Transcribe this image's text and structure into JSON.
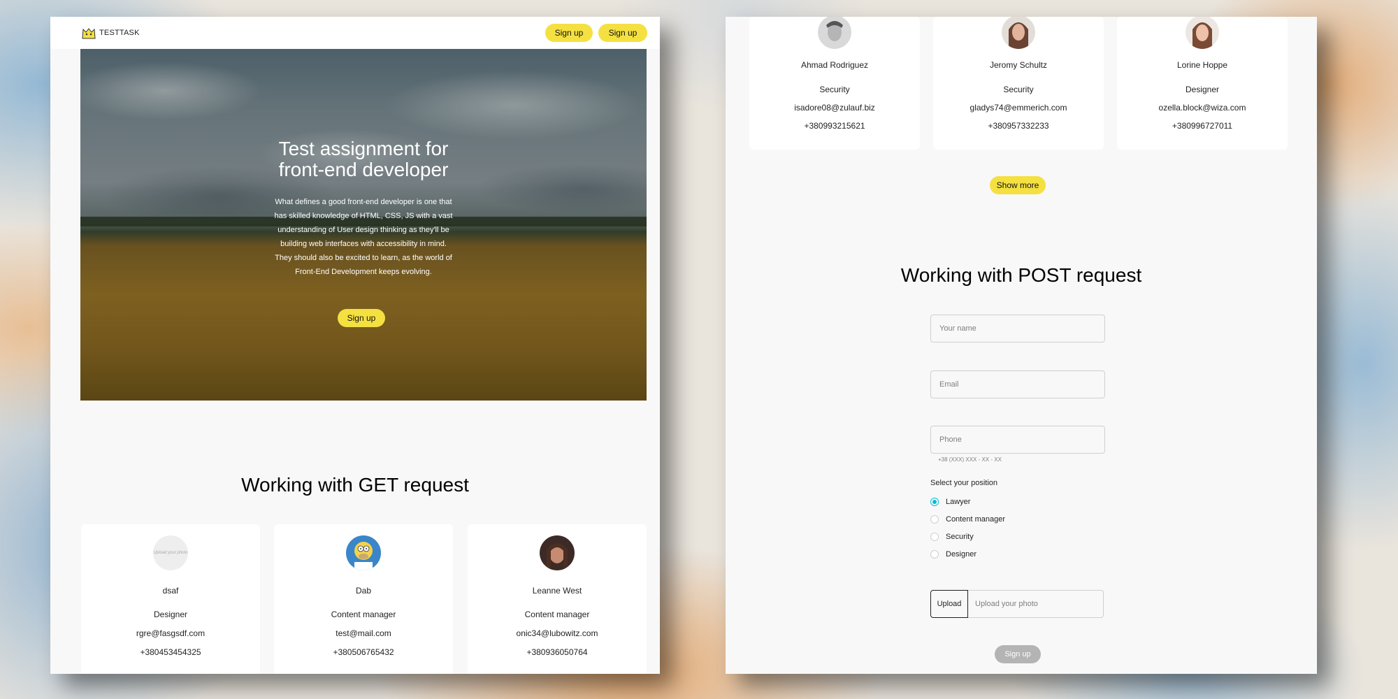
{
  "left_page": {
    "header": {
      "logo_text": "TESTTASK",
      "signup_label_1": "Sign up",
      "signup_label_2": "Sign up"
    },
    "hero": {
      "title_line1": "Test assignment for",
      "title_line2": "front-end developer",
      "text": "What defines a good front-end developer is one that has skilled knowledge of HTML, CSS, JS with a vast understanding of User design thinking as they'll be building web interfaces with accessibility in mind. They should also be excited to learn, as the world of Front-End Development keeps evolving.",
      "signup_label": "Sign up"
    },
    "get_section": {
      "title": "Working with GET request",
      "cards": [
        {
          "name": "dsaf",
          "position": "Designer",
          "email": "rgre@fasgsdf.com",
          "phone": "+380453454325",
          "avatar": "broken-photo-avatar",
          "avatar_text": "Upload your photo"
        },
        {
          "name": "Dab",
          "position": "Content manager",
          "email": "test@mail.com",
          "phone": "+380506765432",
          "avatar": "cartoon-avatar"
        },
        {
          "name": "Leanne West",
          "position": "Content manager",
          "email": "onic34@lubowitz.com",
          "phone": "+380936050764",
          "avatar": "photo-avatar"
        }
      ]
    }
  },
  "right_page": {
    "cards": [
      {
        "name": "Ahmad Rodriguez",
        "position": "Security",
        "email": "isadore08@zulauf.biz",
        "phone": "+380993215621",
        "avatar": "photo-avatar"
      },
      {
        "name": "Jeromy Schultz",
        "position": "Security",
        "email": "gladys74@emmerich.com",
        "phone": "+380957332233",
        "avatar": "photo-avatar"
      },
      {
        "name": "Lorine Hoppe",
        "position": "Designer",
        "email": "ozella.block@wiza.com",
        "phone": "+380996727011",
        "avatar": "photo-avatar"
      }
    ],
    "show_more_label": "Show more",
    "post_section": {
      "title": "Working with POST request",
      "name_placeholder": "Your name",
      "email_placeholder": "Email",
      "phone_placeholder": "Phone",
      "phone_helper": "+38 (XXX) XXX - XX - XX",
      "select_label": "Select your position",
      "positions": [
        {
          "label": "Lawyer",
          "selected": true
        },
        {
          "label": "Content manager",
          "selected": false
        },
        {
          "label": "Security",
          "selected": false
        },
        {
          "label": "Designer",
          "selected": false
        }
      ],
      "upload_button": "Upload",
      "upload_placeholder": "Upload your photo",
      "submit_label": "Sign up"
    }
  },
  "colors": {
    "accent_yellow": "#f4e041",
    "radio_accent": "#00bdd3",
    "disabled_button": "#b4b4b4",
    "page_bg": "#f8f8f8"
  }
}
